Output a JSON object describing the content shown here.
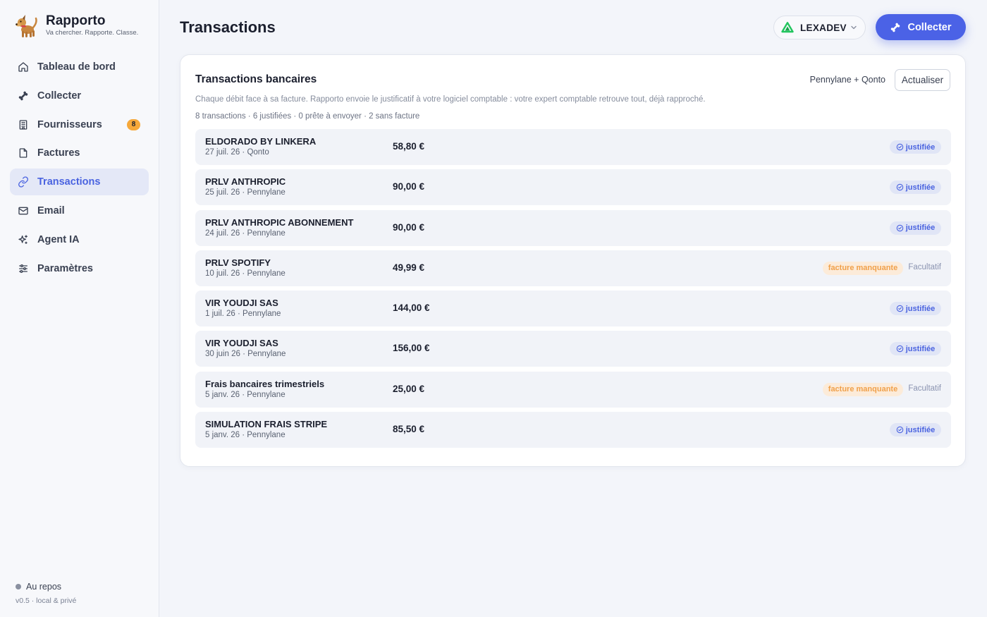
{
  "brand": {
    "name": "Rapporto",
    "tagline": "Va chercher. Rapporte. Classe.",
    "logo": "dog-logo"
  },
  "nav": [
    {
      "label": "Tableau de bord",
      "icon": "home-icon",
      "active": false
    },
    {
      "label": "Collecter",
      "icon": "bone-icon",
      "active": false
    },
    {
      "label": "Fournisseurs",
      "icon": "building-icon",
      "active": false,
      "badge": "8"
    },
    {
      "label": "Factures",
      "icon": "file-icon",
      "active": false
    },
    {
      "label": "Transactions",
      "icon": "link-icon",
      "active": true
    },
    {
      "label": "Email",
      "icon": "mail-icon",
      "active": false
    },
    {
      "label": "Agent IA",
      "icon": "sparkles-icon",
      "active": false
    },
    {
      "label": "Paramètres",
      "icon": "sliders-icon",
      "active": false
    }
  ],
  "footer": {
    "status": "Au repos",
    "version": "v0.5 · local & privé"
  },
  "header": {
    "title": "Transactions",
    "company": "LEXADEV",
    "collect_label": "Collecter"
  },
  "card": {
    "title": "Transactions bancaires",
    "source": "Pennylane + Qonto",
    "refresh_label": "Actualiser",
    "description": "Chaque débit face à sa facture. Rapporto envoie le justificatif à votre logiciel comptable : votre expert comptable retrouve tout, déjà rapproché.",
    "stats": "8 transactions · 6 justifiées · 0 prête à envoyer · 2 sans facture"
  },
  "transactions": [
    {
      "name": "ELDORADO BY LINKERA",
      "meta": "27 juil. 26 · Qonto",
      "amount": "58,80 €",
      "status": "justifiée"
    },
    {
      "name": "PRLV ANTHROPIC",
      "meta": "25 juil. 26 · Pennylane",
      "amount": "90,00 €",
      "status": "justifiée"
    },
    {
      "name": "PRLV ANTHROPIC ABONNEMENT",
      "meta": "24 juil. 26 · Pennylane",
      "amount": "90,00 €",
      "status": "justifiée"
    },
    {
      "name": "PRLV SPOTIFY",
      "meta": "10 juil. 26 · Pennylane",
      "amount": "49,99 €",
      "status": "facture manquante",
      "optional": "Facultatif"
    },
    {
      "name": "VIR YOUDJI SAS",
      "meta": "1 juil. 26 · Pennylane",
      "amount": "144,00 €",
      "status": "justifiée"
    },
    {
      "name": "VIR YOUDJI SAS",
      "meta": "30 juin 26 · Pennylane",
      "amount": "156,00 €",
      "status": "justifiée"
    },
    {
      "name": "Frais bancaires trimestriels",
      "meta": "5 janv. 26 · Pennylane",
      "amount": "25,00 €",
      "status": "facture manquante",
      "optional": "Facultatif"
    },
    {
      "name": "SIMULATION FRAIS STRIPE",
      "meta": "5 janv. 26 · Pennylane",
      "amount": "85,50 €",
      "status": "justifiée"
    }
  ],
  "colors": {
    "accent": "#4b62e6",
    "active_bg": "#e4e8f7",
    "badge": "#f6a83a",
    "missing_text": "#f0a04a",
    "missing_bg": "#fcebd9",
    "ok_bg": "#e0e5f6"
  }
}
